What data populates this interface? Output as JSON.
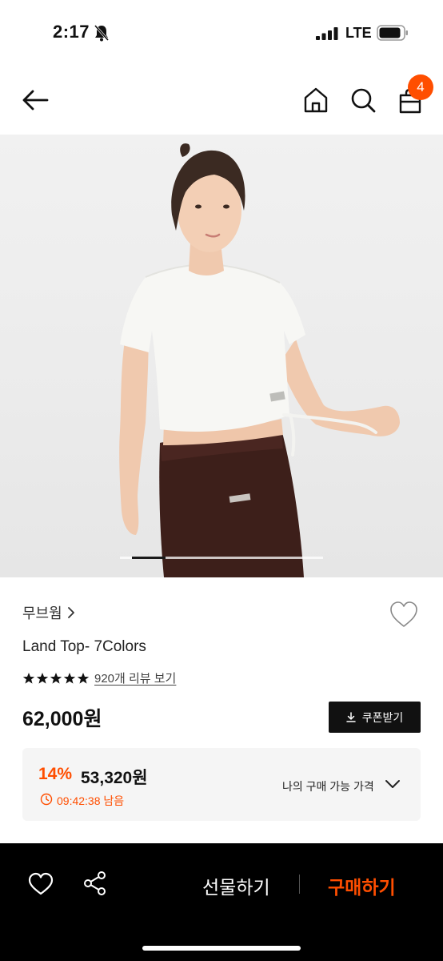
{
  "status_bar": {
    "time": "2:17",
    "network": "LTE",
    "icons": [
      "bell-off-icon",
      "signal-icon",
      "battery-icon"
    ]
  },
  "header": {
    "icons": [
      "back-icon",
      "home-icon",
      "search-icon",
      "bag-icon"
    ],
    "cart_count": "4"
  },
  "carousel": {
    "current_index": 2,
    "total_images": 6
  },
  "product": {
    "brand": "무브웜",
    "title": "Land Top- 7Colors",
    "rating_stars": 5,
    "review_link": "920개 리뷰 보기",
    "price": "62,000원",
    "coupon_label": "쿠폰받기"
  },
  "discount": {
    "rate": "14%",
    "price": "53,320원",
    "countdown": "09:42:38 남음",
    "my_price_label": "나의 구매 가능 가격"
  },
  "bottom_bar": {
    "gift_label": "선물하기",
    "buy_label": "구매하기"
  },
  "colors": {
    "accent": "#ff4e00",
    "bottom_bar_bg": "#000000",
    "coupon_bg": "#111111",
    "discount_bg": "#f5f5f5"
  }
}
